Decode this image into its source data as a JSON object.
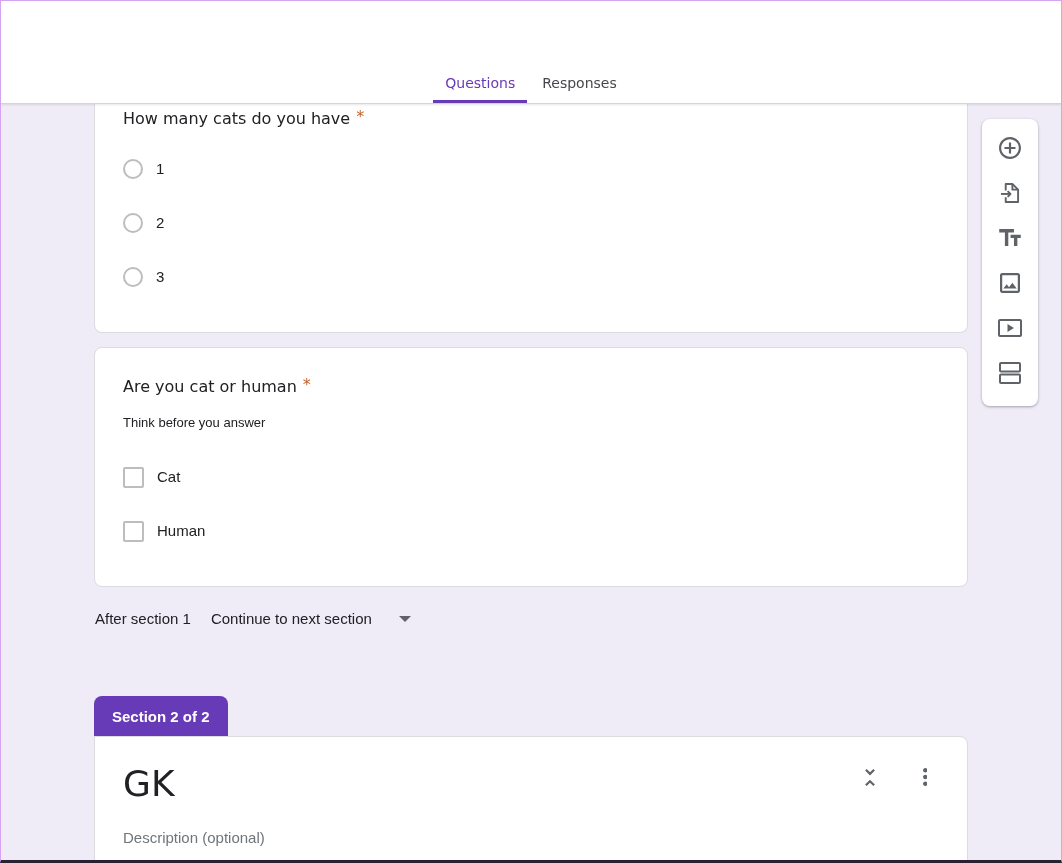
{
  "tabs": [
    {
      "label": "Questions",
      "selected": true
    },
    {
      "label": "Responses",
      "selected": false
    }
  ],
  "questions": [
    {
      "kind": "radio",
      "title": "How many cats do you have",
      "required_mark": "*",
      "options": [
        {
          "label": "1",
          "selected": false
        },
        {
          "label": "2",
          "selected": false
        },
        {
          "label": "3",
          "selected": false
        }
      ]
    },
    {
      "kind": "checkbox",
      "title": "Are you cat or human",
      "required_mark": "*",
      "description": "Think before you answer",
      "options": [
        {
          "label": "Cat",
          "checked": false
        },
        {
          "label": "Human",
          "checked": false
        }
      ]
    }
  ],
  "after_section": {
    "label": "After section 1",
    "value": "Continue to next section"
  },
  "section": {
    "tab_label": "Section 2 of 2",
    "title": "GK",
    "description": {
      "placeholder": "Description (optional)"
    }
  }
}
